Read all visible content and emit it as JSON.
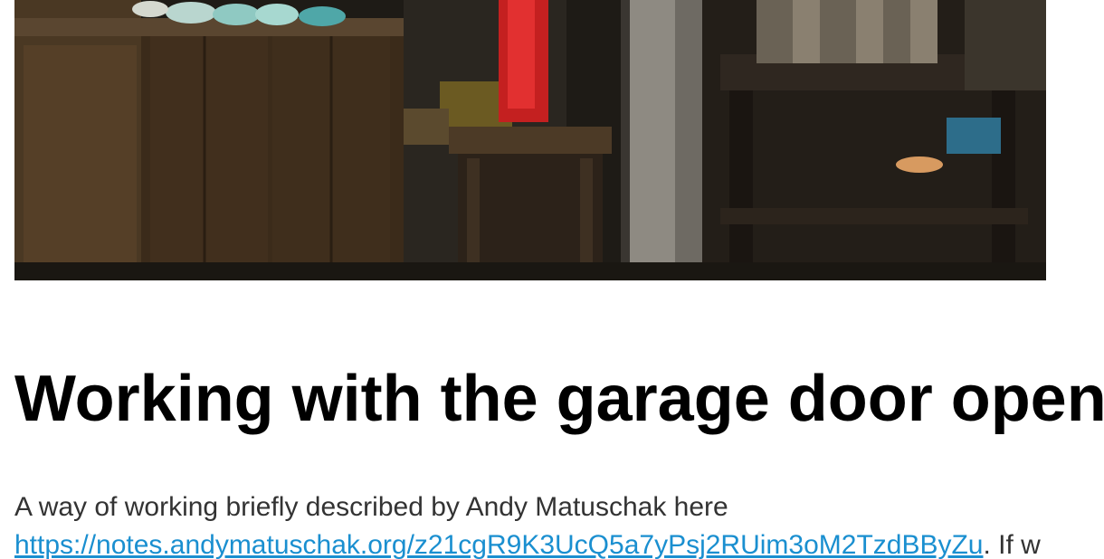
{
  "article": {
    "title": "Working with the garage door open",
    "intro": "A way of working briefly described by Andy Matuschak here",
    "link_text": "https://notes.andymatuschak.org/z21cgR9K3UcQ5a7yPsj2RUim3oM2TzdBByZu",
    "after_link": ". If w"
  },
  "colors": {
    "link": "#1a8fd0",
    "title": "#000000",
    "body_text": "#333333"
  }
}
